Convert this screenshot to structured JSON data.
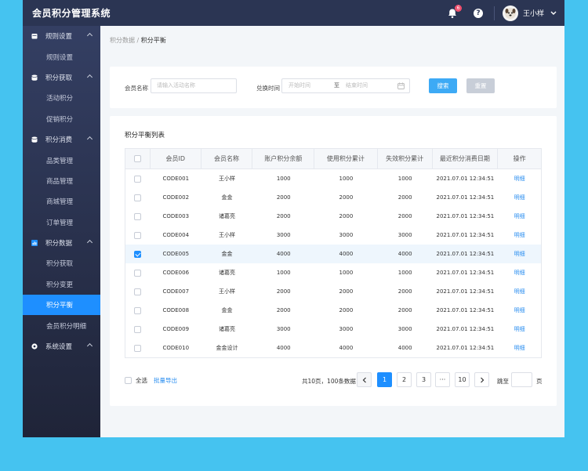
{
  "app": {
    "title": "会员积分管理系统"
  },
  "topbar": {
    "notification_count": "6",
    "help_label": "?",
    "user_name": "王小样"
  },
  "sidebar": {
    "groups": [
      {
        "label": "规则设置",
        "icon": "calendar-icon",
        "items": [
          {
            "label": "规则设置"
          }
        ]
      },
      {
        "label": "积分获取",
        "icon": "database-icon",
        "items": [
          {
            "label": "活动积分"
          },
          {
            "label": "促销积分"
          }
        ]
      },
      {
        "label": "积分消费",
        "icon": "database-icon",
        "items": [
          {
            "label": "品类管理"
          },
          {
            "label": "商品管理"
          },
          {
            "label": "商城管理"
          },
          {
            "label": "订单管理"
          }
        ]
      },
      {
        "label": "积分数据",
        "icon": "chart-icon",
        "items": [
          {
            "label": "积分获取"
          },
          {
            "label": "积分变更"
          },
          {
            "label": "积分平衡"
          },
          {
            "label": "会员积分明细"
          }
        ]
      },
      {
        "label": "系统设置",
        "icon": "settings-icon",
        "items": []
      }
    ]
  },
  "breadcrumb": {
    "parent": "积分数据",
    "separator": "/",
    "current": "积分平衡"
  },
  "filter": {
    "member_label": "会员名称",
    "member_placeholder": "请输入活动名称",
    "time_label": "兑换时间",
    "start_placeholder": "开始时间",
    "to_label": "至",
    "end_placeholder": "结束时间",
    "search_label": "搜索",
    "reset_label": "重置"
  },
  "table": {
    "title": "积分平衡列表",
    "headers": [
      "会员ID",
      "会员名称",
      "账户积分余额",
      "使用积分累计",
      "失效积分累计",
      "最近积分消费日期",
      "操作"
    ],
    "rows": [
      {
        "id": "CODE001",
        "name": "王小样",
        "balance": "1000",
        "used": "1000",
        "expired": "1000",
        "date": "2021.07.01 12:34:51",
        "op": "明细",
        "checked": false
      },
      {
        "id": "CODE002",
        "name": "金金",
        "balance": "2000",
        "used": "2000",
        "expired": "2000",
        "date": "2021.07.01 12:34:51",
        "op": "明细",
        "checked": false
      },
      {
        "id": "CODE003",
        "name": "诸葛亮",
        "balance": "2000",
        "used": "2000",
        "expired": "2000",
        "date": "2021.07.01 12:34:51",
        "op": "明细",
        "checked": false
      },
      {
        "id": "CODE004",
        "name": "王小样",
        "balance": "3000",
        "used": "3000",
        "expired": "3000",
        "date": "2021.07.01 12:34:51",
        "op": "明细",
        "checked": false
      },
      {
        "id": "CODE005",
        "name": "金金",
        "balance": "4000",
        "used": "4000",
        "expired": "4000",
        "date": "2021.07.01 12:34:51",
        "op": "明细",
        "checked": true
      },
      {
        "id": "CODE006",
        "name": "诸葛亮",
        "balance": "1000",
        "used": "1000",
        "expired": "1000",
        "date": "2021.07.01 12:34:51",
        "op": "明细",
        "checked": false
      },
      {
        "id": "CODE007",
        "name": "王小样",
        "balance": "2000",
        "used": "2000",
        "expired": "2000",
        "date": "2021.07.01 12:34:51",
        "op": "明细",
        "checked": false
      },
      {
        "id": "CODE008",
        "name": "金金",
        "balance": "2000",
        "used": "2000",
        "expired": "2000",
        "date": "2021.07.01 12:34:51",
        "op": "明细",
        "checked": false
      },
      {
        "id": "CODE009",
        "name": "诸葛亮",
        "balance": "3000",
        "used": "3000",
        "expired": "3000",
        "date": "2021.07.01 12:34:51",
        "op": "明细",
        "checked": false
      },
      {
        "id": "CODE010",
        "name": "金金设计",
        "balance": "4000",
        "used": "4000",
        "expired": "4000",
        "date": "2021.07.01 12:34:51",
        "op": "明细",
        "checked": false
      }
    ]
  },
  "footer": {
    "select_all_label": "全选",
    "export_label": "批量导出",
    "total_text": "共10页，100条数据",
    "pages": [
      "1",
      "2",
      "3",
      "···",
      "10"
    ],
    "current_page": "1",
    "jump_label": "跳至",
    "page_unit": "页"
  },
  "colors": {
    "accent": "#1e8fff",
    "topbar": "#2b3553",
    "background": "#45c3f0"
  }
}
